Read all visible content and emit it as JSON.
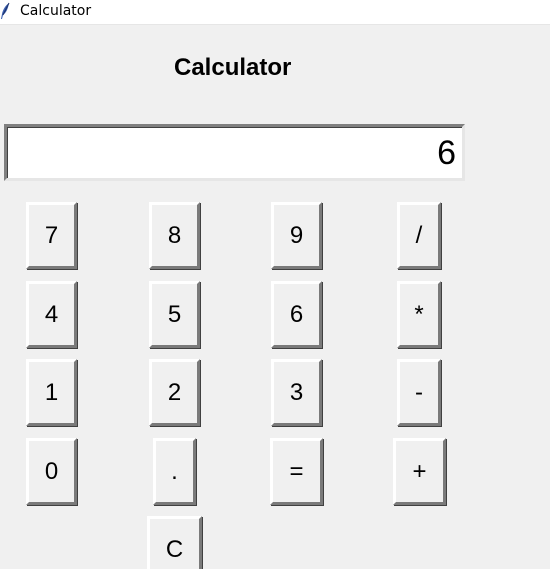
{
  "window": {
    "title": "Calculator",
    "icon": "feather-icon"
  },
  "header": {
    "title": "Calculator"
  },
  "display": {
    "value": "6"
  },
  "keys": [
    {
      "label": "7",
      "name": "key-7"
    },
    {
      "label": "8",
      "name": "key-8"
    },
    {
      "label": "9",
      "name": "key-9"
    },
    {
      "label": "/",
      "name": "key-divide"
    },
    {
      "label": "4",
      "name": "key-4"
    },
    {
      "label": "5",
      "name": "key-5"
    },
    {
      "label": "6",
      "name": "key-6"
    },
    {
      "label": "*",
      "name": "key-multiply"
    },
    {
      "label": "1",
      "name": "key-1"
    },
    {
      "label": "2",
      "name": "key-2"
    },
    {
      "label": "3",
      "name": "key-3"
    },
    {
      "label": "-",
      "name": "key-subtract"
    },
    {
      "label": "0",
      "name": "key-0"
    },
    {
      "label": ".",
      "name": "key-decimal"
    },
    {
      "label": "=",
      "name": "key-equals"
    },
    {
      "label": "+",
      "name": "key-add"
    },
    {
      "label": "C",
      "name": "key-clear"
    }
  ]
}
